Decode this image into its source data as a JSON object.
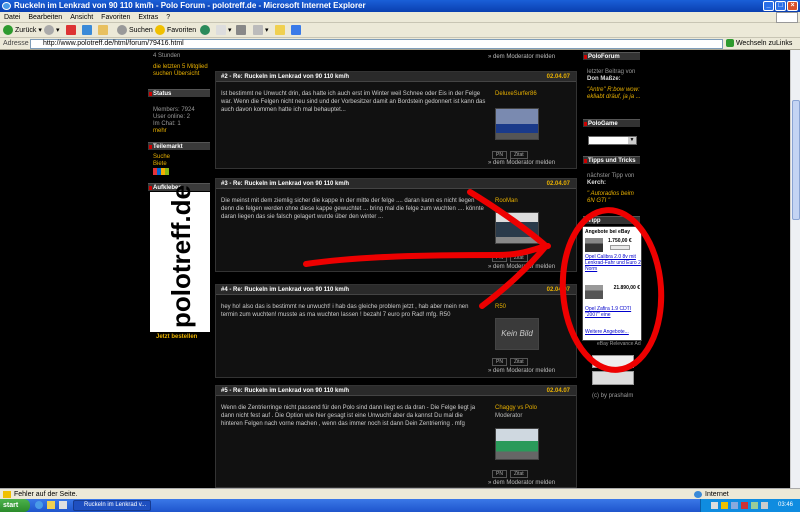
{
  "window": {
    "title": "Ruckeln im Lenkrad von 90 110 km/h - Polo Forum - polotreff.de - Microsoft Internet Explorer"
  },
  "menu": [
    "Datei",
    "Bearbeiten",
    "Ansicht",
    "Favoriten",
    "Extras",
    "?"
  ],
  "toolbar": {
    "back": "Zurück",
    "search": "Suchen",
    "favorites": "Favoriten"
  },
  "address": {
    "label": "Adresse",
    "url": "http://www.polotreff.de/html/forum/79416.html",
    "go": "Wechseln zu",
    "links": "Links"
  },
  "left_sidebar": {
    "stunden": "4 Stunden",
    "last5": "die letzten 5 Mitglied suchen Übersicht",
    "status_header": "Status",
    "members": "Members: 7924",
    "online": "User online: 2",
    "chat": "Im Chat: 1",
    "mehr": "mehr",
    "teilemarkt_header": "Teilemarkt",
    "suche": "Suche",
    "biete": "Biete",
    "aufkleber_header": "Aufkleber",
    "banner_text": "polotreff.de",
    "jetzt": "Jetzt bestellen"
  },
  "posts": [
    {
      "title": "#2 - Re: Ruckeln im Lenkrad von 90 110 km/h",
      "date": "02.04.07",
      "body": "Ist bestimmt ne Unwucht drin, das hatte ich auch erst im Winter weil Schnee oder Eis in der Felge war. Wenn die Felgen nicht neu sind und der Vorbesitzer damit an Bordstein gedonnert ist kann das auch davon kommen hatte ich mal behauptet...",
      "user": "DeluxeSurfer86"
    },
    {
      "title": "#3 - Re: Ruckeln im Lenkrad von 90 110 km/h",
      "date": "02.04.07",
      "body": "Die meinst mit dem ziemlig sicher die kappe in der mitte der felge .... daran kann es nicht liegen denn die felgen werden ohne diese kappe gewuchtet ... bring mal die felge zum wuchten .... könnte daran liegen das sie falsch gelagert wurde über den winter ...",
      "user": "RooMan"
    },
    {
      "title": "#4 - Re: Ruckeln im Lenkrad von 90 110 km/h",
      "date": "02.04.07",
      "body": "hey ho! also das is bestimmt ne unwucht! i hab das gleiche problem jetzt , hab aber mein nen termin zum wuchten! musste as ma wuchten lassen ! bezahl 7 euro pro Rad! mfg. R50",
      "user": "R50",
      "avatar_text": "Kein Bild"
    },
    {
      "title": "#5 - Re: Ruckeln im Lenkrad von 90 110 km/h",
      "date": "02.04.07",
      "body": "Wenn die Zentrierringe nicht passend für den Polo sind dann liegt es da dran - Die Felge liegt ja dann nicht fest auf . Die Option wie hier gesagt ist eine Unwucht aber da kannst Du mal die hinteren Felgen nach vorne machen , wenn das immer noch ist dann Dein Zentrierring . mfg",
      "user": "Chaggy vs Polo",
      "role": "Moderator"
    }
  ],
  "post_buttons": {
    "pm": "PN",
    "zitat": "Zitat",
    "report": "» dem Moderator melden"
  },
  "right_sidebar": {
    "poloforum_header": "PoloForum",
    "letzter": "letzter Beitrag von",
    "letzter_user": "Don Maßze:",
    "letzter_text": "\"Antre\" R:bow wow: ekliabt dräuf, ja ja ...",
    "pologame_header": "PoloGame",
    "tipps_header": "Tipps und Tricks",
    "naechster": "nächster Tipp von",
    "naechster_user": "Kerch:",
    "tipp_text": "\" Autoradios beim 6N GTI \"",
    "tipp_header": "Tipp",
    "ebay_title": "Angebote bei eBay",
    "ebay1_price": "1.750,00 €",
    "ebay1_link": "Opel Calibra 2.0 8v mit Lenkrad-Fahr und Euro 2 Norm",
    "ebay2_price": "21.890,00 €",
    "ebay2_link": "Opel Zafira 1.9 CDTI \"2007\" eine",
    "ebay_more": "Weitere Angebote...",
    "ebay_footer": "eBay Relevance Ad",
    "credits": "(c) by prashalm"
  },
  "status": {
    "text": "Fehler auf der Seite.",
    "zone": "Internet"
  },
  "taskbar": {
    "start": "start",
    "item": "Ruckeln im Lenkrad v...",
    "clock": "03:46"
  }
}
